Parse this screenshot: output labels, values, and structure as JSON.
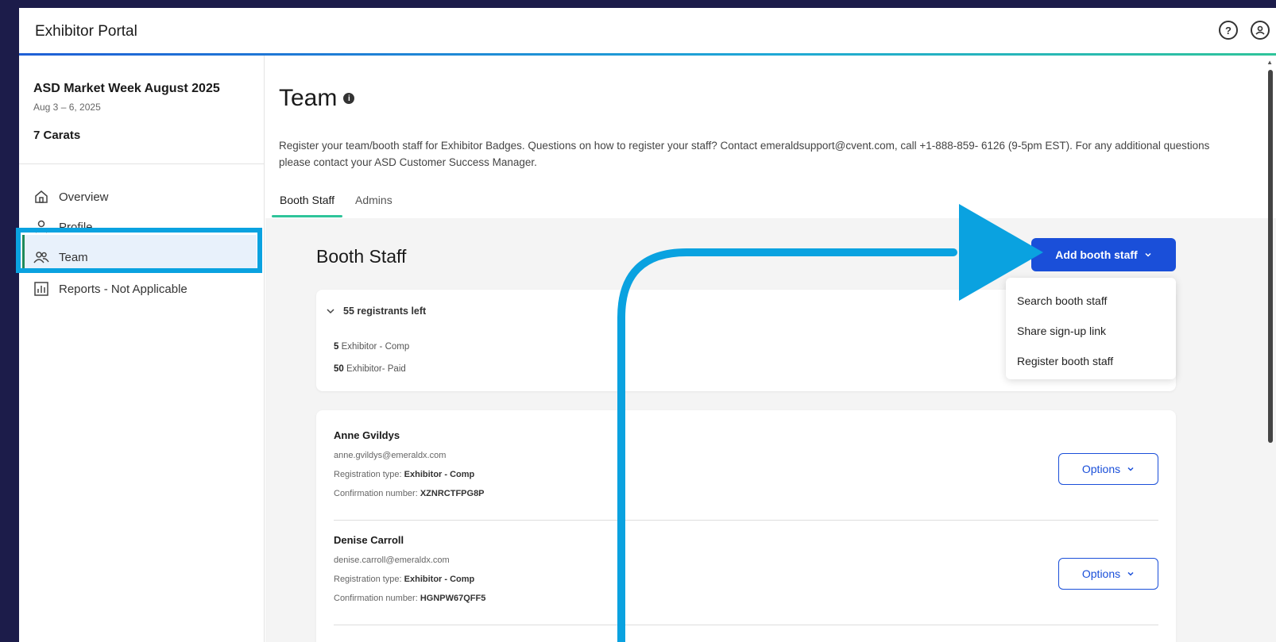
{
  "header": {
    "title": "Exhibitor Portal",
    "help_icon": "question-circle-icon",
    "account_icon": "user-circle-icon"
  },
  "sidebar": {
    "event_name": "ASD Market Week August 2025",
    "event_dates": "Aug 3 – 6, 2025",
    "company": "7 Carats",
    "items": [
      {
        "label": "Overview",
        "icon": "home-icon"
      },
      {
        "label": "Profile",
        "icon": "person-icon"
      },
      {
        "label": "Team",
        "icon": "people-icon",
        "active": true
      },
      {
        "label": "Reports - Not Applicable",
        "icon": "bar-chart-icon"
      }
    ]
  },
  "main": {
    "title": "Team",
    "description": "Register your team/booth staff for Exhibitor Badges. Questions on how to register your staff? Contact emeraldsupport@cvent.com, call +1-888-859- 6126 (9-5pm EST). For any additional questions please contact your ASD Customer Success Manager.",
    "tabs": [
      {
        "label": "Booth Staff",
        "active": true
      },
      {
        "label": "Admins"
      }
    ],
    "section_title": "Booth Staff",
    "add_button": "Add booth staff",
    "dropdown_items": [
      "Search booth staff",
      "Share sign-up link",
      "Register booth staff"
    ],
    "summary": {
      "heading": "55 registrants left",
      "lines": [
        {
          "count": "5",
          "label": "Exhibitor - Comp"
        },
        {
          "count": "50",
          "label": "Exhibitor- Paid"
        }
      ]
    },
    "staff": [
      {
        "name": "Anne Gvildys",
        "email": "anne.gvildys@emeraldx.com",
        "reg_label": "Registration type:",
        "reg_type": "Exhibitor - Comp",
        "conf_label": "Confirmation number:",
        "conf_number": "XZNRCTFPG8P",
        "options_label": "Options"
      },
      {
        "name": "Denise Carroll",
        "email": "denise.carroll@emeraldx.com",
        "reg_label": "Registration type:",
        "reg_type": "Exhibitor - Comp",
        "conf_label": "Confirmation number:",
        "conf_number": "HGNPW67QFF5",
        "options_label": "Options"
      }
    ]
  },
  "colors": {
    "accent_blue": "#1a4fd9",
    "highlight": "#0aa2e0",
    "tab_underline": "#2fc49a",
    "background": "#1c1c4a"
  }
}
